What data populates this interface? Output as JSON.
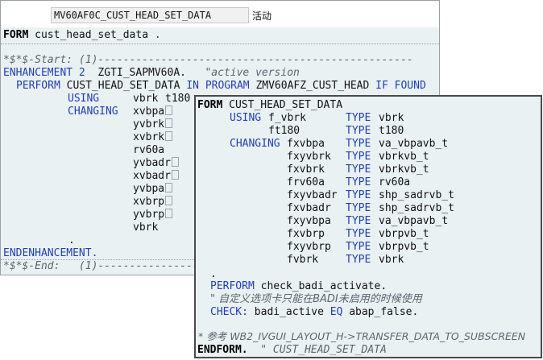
{
  "header": {
    "program_name": "MV60AF0C_CUST_HEAD_SET_DATA",
    "status": "活动"
  },
  "back_editor": {
    "form_kw": "FORM",
    "form_name": "cust_head_set_data",
    "form_dot": ".",
    "start_comment": "*$*$-Start: (1)--------------------------------------------------",
    "enh_kw": "ENHANCEMENT",
    "enh_num": "2",
    "enh_name": "ZGTI_SAPMV60A.",
    "enh_comment": "\"active version",
    "perform_kw": "PERFORM",
    "perform_name": "CUST_HEAD_SET_DATA",
    "in_program_kw": "IN PROGRAM",
    "program": "ZMV60AFZ_CUST_HEAD",
    "if_found_kw": "IF FOUND",
    "using_kw": "USING",
    "using_params": [
      "vbrk",
      "t180"
    ],
    "changing_kw": "CHANGING",
    "changing_params": [
      "xvbpa",
      "yvbrk",
      "xvbrk",
      "rv60a",
      "yvbadr",
      "xvbadr",
      "yvbpa",
      "xvbrp",
      "yvbrp",
      "vbrk"
    ],
    "param_boxes": [
      true,
      true,
      true,
      false,
      true,
      true,
      true,
      true,
      true,
      false
    ],
    "dot": ".",
    "endenh_kw": "ENDENHANCEMENT.",
    "end_comment": "*$*$-End:   (1)--------------------------------------------------"
  },
  "popup_editor": {
    "form_kw": "FORM",
    "form_name": "CUST_HEAD_SET_DATA",
    "using_kw": "USING",
    "type_kw": "TYPE",
    "using_params": [
      {
        "name": "f_vbrk",
        "type": "vbrk"
      },
      {
        "name": "ft180",
        "type": "t180"
      }
    ],
    "changing_kw": "CHANGING",
    "changing_params": [
      {
        "name": "fxvbpa",
        "type": "va_vbpavb_t"
      },
      {
        "name": "fxyvbrk",
        "type": "vbrkvb_t"
      },
      {
        "name": "fxvbrk",
        "type": "vbrkvb_t"
      },
      {
        "name": "frv60a",
        "type": "rv60a"
      },
      {
        "name": "fxyvbadr",
        "type": "shp_sadrvb_t"
      },
      {
        "name": "fxvbadr",
        "type": "shp_sadrvb_t"
      },
      {
        "name": "fxyvbpa",
        "type": "va_vbpavb_t"
      },
      {
        "name": "fxvbrp",
        "type": "vbrpvb_t"
      },
      {
        "name": "fxyvbrp",
        "type": "vbrpvb_t"
      },
      {
        "name": "fvbrk",
        "type": "vbrk"
      }
    ],
    "dot": ".",
    "perform_kw": "PERFORM",
    "perform_rest": "check_badi_activate.",
    "comment_cn": "\" 自定义选项卡只能在BADI未启用的时候使用",
    "check_kw": "CHECK:",
    "check_var": "badi_active",
    "eq_kw": "EQ",
    "check_val": "abap_false.",
    "ref_comment": "* 参考 WB2_IVGUI_LAYOUT_H->TRANSFER_DATA_TO_SUBSCREEN",
    "endform_kw": "ENDFORM.",
    "endform_comment": "\" CUST_HEAD_SET_DATA"
  }
}
